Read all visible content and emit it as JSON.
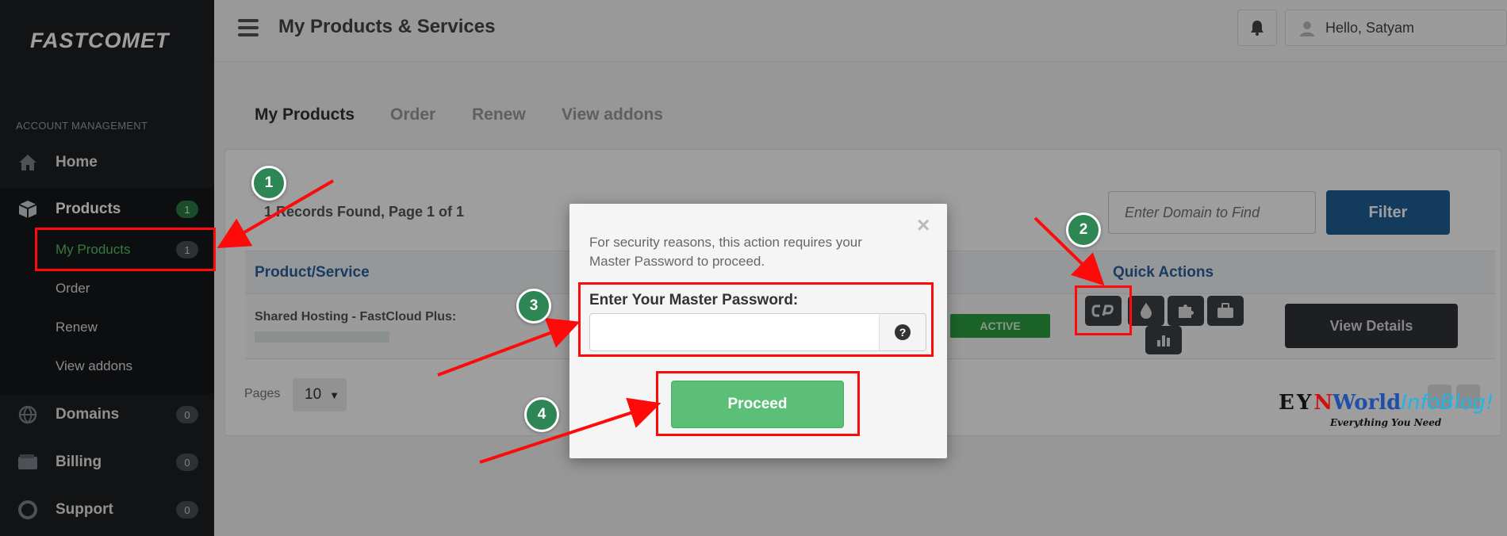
{
  "sidebar": {
    "logo": "FASTCOMET",
    "section_label": "ACCOUNT MANAGEMENT",
    "items": [
      {
        "label": "Home",
        "icon": "home-icon"
      },
      {
        "label": "Products",
        "badge": "1",
        "icon": "box-icon"
      },
      {
        "label": "Domains",
        "badge": "0",
        "icon": "globe-icon"
      },
      {
        "label": "Billing",
        "badge": "0",
        "icon": "wallet-icon"
      },
      {
        "label": "Support",
        "badge": "0",
        "icon": "lifebuoy-icon"
      }
    ],
    "subitems": [
      {
        "label": "My Products",
        "badge": "1"
      },
      {
        "label": "Order"
      },
      {
        "label": "Renew"
      },
      {
        "label": "View addons"
      }
    ]
  },
  "topbar": {
    "title": "My Products & Services",
    "user_greeting": "Hello, Satyam"
  },
  "tabs": [
    "My Products",
    "Order",
    "Renew",
    "View addons"
  ],
  "records_text": "1 Records Found, Page 1 of 1",
  "search": {
    "placeholder": "Enter Domain to Find",
    "filter_label": "Filter"
  },
  "table": {
    "headers": {
      "product": "Product/Service",
      "quick_actions": "Quick Actions"
    },
    "row": {
      "product": "Shared Hosting - FastCloud Plus:",
      "status": "ACTIVE",
      "view_details": "View Details"
    }
  },
  "pagination": {
    "label": "Pages",
    "per_page": "10"
  },
  "modal": {
    "message": "For security reasons, this action requires your Master Password to proceed.",
    "password_label": "Enter Your Master Password:",
    "password_value": "",
    "help": "?",
    "proceed_label": "Proceed",
    "close": "×"
  },
  "steps": [
    "1",
    "2",
    "3",
    "4"
  ],
  "watermark": {
    "part1": "EY",
    "part2": "N",
    "part3": "World",
    "part4": "InfoBlog!",
    "tagline": "Everything You Need"
  },
  "colors": {
    "sidebar_bg": "#1c1f22",
    "active_green": "#54c56a",
    "filter_blue": "#1f5f96",
    "proceed_green": "#5bbf78",
    "annotation_red": "#ff0a0a",
    "step_badge_green": "#2d8653"
  }
}
